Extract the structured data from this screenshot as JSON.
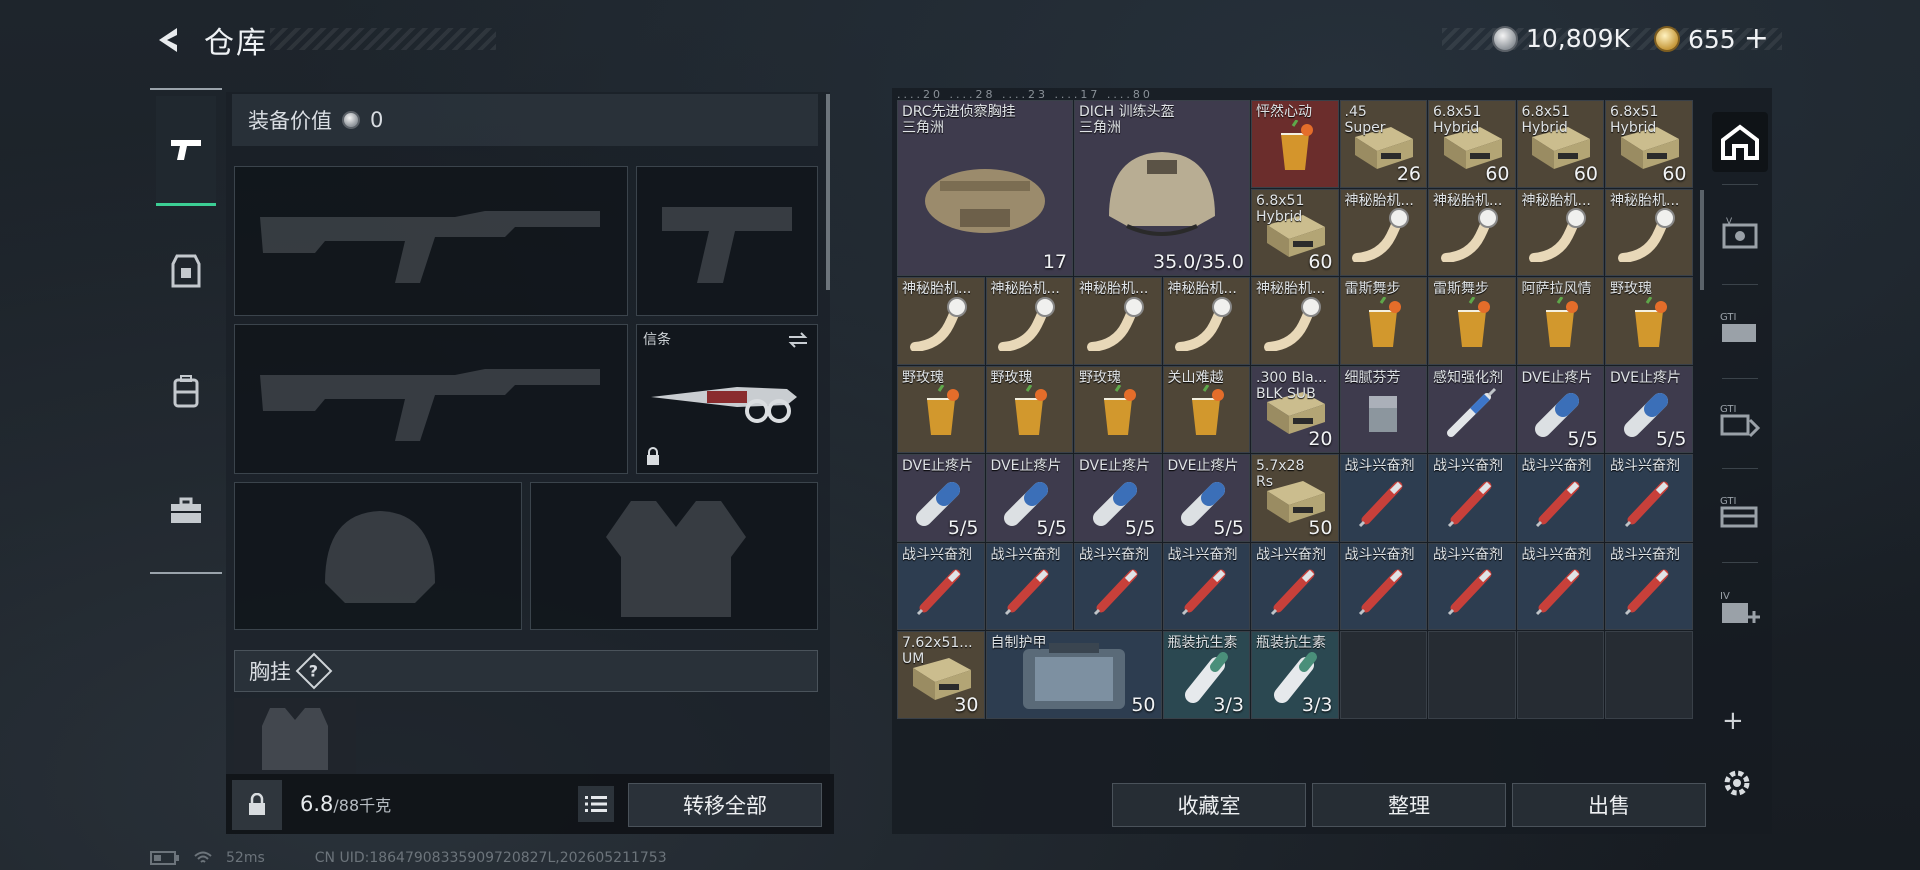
{
  "header": {
    "title": "仓库"
  },
  "currency": {
    "silver": "10,809K",
    "gold": "655",
    "plus": "+"
  },
  "left_nav": [
    "pistol-icon",
    "rig-icon",
    "backpack-icon",
    "briefcase-icon"
  ],
  "equipment": {
    "value_label": "装备价值",
    "value": "0",
    "melee_label": "信条",
    "chest_rig_label": "胸挂",
    "help": "?",
    "weight_value": "6.8",
    "weight_sep_max": "/88千克",
    "transfer_all": "转移全部"
  },
  "inventory": {
    "top_strip": "....20 ....28 ....23 ....17 ....80",
    "items": [
      {
        "n": "DRC先进侦察胸挂\n三角洲",
        "c": "17",
        "icon": "bag-icon",
        "bg": "purple"
      },
      {
        "n": "DICH 训练头盔\n三角洲",
        "c": "35.0/35.0",
        "icon": "helmet-icon",
        "bg": "purple"
      },
      {
        "n": "怦然心动",
        "c": "",
        "icon": "cocktail-icon",
        "bg": "red"
      },
      {
        "n": ".45\nSuper",
        "c": "26",
        "icon": "ammo-box-icon",
        "bg": "gold"
      },
      {
        "n": "6.8x51\nHybrid",
        "c": "60",
        "icon": "ammo-box-icon",
        "bg": "gold"
      },
      {
        "n": "6.8x51\nHybrid",
        "c": "60",
        "icon": "ammo-box-icon",
        "bg": "gold"
      },
      {
        "n": "6.8x51\nHybrid",
        "c": "60",
        "icon": "ammo-box-icon",
        "bg": "gold"
      },
      {
        "n": "6.8x51\nHybrid",
        "c": "60",
        "icon": "ammo-box-icon",
        "bg": "gold"
      },
      {
        "n": "神秘胎机...",
        "c": "",
        "icon": "horn-icon",
        "bg": "gold"
      },
      {
        "n": "雷斯舞步",
        "c": "",
        "icon": "cocktail-icon",
        "bg": "gold"
      },
      {
        "n": "阿萨拉风情",
        "c": "",
        "icon": "cocktail-icon",
        "bg": "gold"
      },
      {
        "n": "野玫瑰",
        "c": "",
        "icon": "cocktail-icon",
        "bg": "gold"
      },
      {
        "n": "关山难越",
        "c": "",
        "icon": "cocktail-icon",
        "bg": "gold"
      },
      {
        "n": ".300 Bla...\nBLK SUB",
        "c": "20",
        "icon": "ammo-box-icon",
        "bg": "purple"
      },
      {
        "n": "细腻芬芳",
        "c": "",
        "icon": "glass-icon",
        "bg": "purple"
      },
      {
        "n": "感知强化剂",
        "c": "",
        "icon": "syringe-icon",
        "bg": "purple"
      },
      {
        "n": "DVE止疼片",
        "c": "5/5",
        "icon": "pill-icon",
        "bg": "purple"
      },
      {
        "n": "5.7x28\nRs",
        "c": "50",
        "icon": "ammo-box-icon",
        "bg": "gold"
      },
      {
        "n": "战斗兴奋剂",
        "c": "",
        "icon": "stim-icon",
        "bg": "blue"
      },
      {
        "n": "7.62x51...\nUM",
        "c": "30",
        "icon": "ammo-box-icon",
        "bg": "gold"
      },
      {
        "n": "自制护甲",
        "c": "50",
        "icon": "armor-icon",
        "bg": "blue"
      },
      {
        "n": "瓶装抗生素",
        "c": "3/3",
        "icon": "bottle-icon",
        "bg": "teal"
      }
    ]
  },
  "actions": {
    "collection": "收藏室",
    "organize": "整理",
    "sell": "出售"
  },
  "right_col": [
    "home-icon",
    "voucher-icon",
    "gti-icon",
    "gti-sort-icon",
    "gti-case-icon",
    "medkit-icon"
  ],
  "add_label": "+",
  "status": {
    "ping": "52ms",
    "uid": "CN UID:18647908335909720827L,202605211753"
  },
  "colors": {
    "accent": "#3ccf95",
    "bg": "#1b2128"
  }
}
